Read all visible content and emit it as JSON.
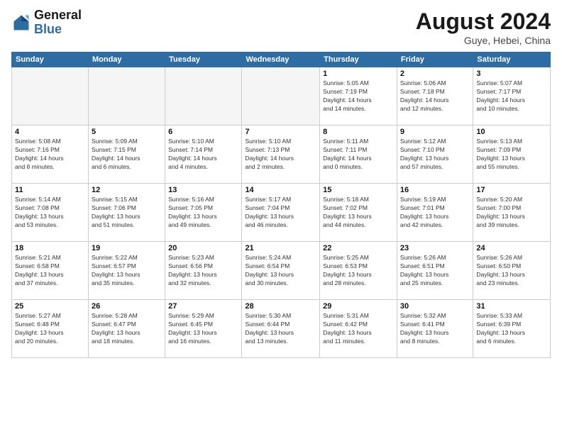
{
  "header": {
    "logo_general": "General",
    "logo_blue": "Blue",
    "month_year": "August 2024",
    "location": "Guye, Hebei, China"
  },
  "weekdays": [
    "Sunday",
    "Monday",
    "Tuesday",
    "Wednesday",
    "Thursday",
    "Friday",
    "Saturday"
  ],
  "weeks": [
    [
      {
        "day": "",
        "detail": ""
      },
      {
        "day": "",
        "detail": ""
      },
      {
        "day": "",
        "detail": ""
      },
      {
        "day": "",
        "detail": ""
      },
      {
        "day": "1",
        "detail": "Sunrise: 5:05 AM\nSunset: 7:19 PM\nDaylight: 14 hours\nand 14 minutes."
      },
      {
        "day": "2",
        "detail": "Sunrise: 5:06 AM\nSunset: 7:18 PM\nDaylight: 14 hours\nand 12 minutes."
      },
      {
        "day": "3",
        "detail": "Sunrise: 5:07 AM\nSunset: 7:17 PM\nDaylight: 14 hours\nand 10 minutes."
      }
    ],
    [
      {
        "day": "4",
        "detail": "Sunrise: 5:08 AM\nSunset: 7:16 PM\nDaylight: 14 hours\nand 8 minutes."
      },
      {
        "day": "5",
        "detail": "Sunrise: 5:09 AM\nSunset: 7:15 PM\nDaylight: 14 hours\nand 6 minutes."
      },
      {
        "day": "6",
        "detail": "Sunrise: 5:10 AM\nSunset: 7:14 PM\nDaylight: 14 hours\nand 4 minutes."
      },
      {
        "day": "7",
        "detail": "Sunrise: 5:10 AM\nSunset: 7:13 PM\nDaylight: 14 hours\nand 2 minutes."
      },
      {
        "day": "8",
        "detail": "Sunrise: 5:11 AM\nSunset: 7:11 PM\nDaylight: 14 hours\nand 0 minutes."
      },
      {
        "day": "9",
        "detail": "Sunrise: 5:12 AM\nSunset: 7:10 PM\nDaylight: 13 hours\nand 57 minutes."
      },
      {
        "day": "10",
        "detail": "Sunrise: 5:13 AM\nSunset: 7:09 PM\nDaylight: 13 hours\nand 55 minutes."
      }
    ],
    [
      {
        "day": "11",
        "detail": "Sunrise: 5:14 AM\nSunset: 7:08 PM\nDaylight: 13 hours\nand 53 minutes."
      },
      {
        "day": "12",
        "detail": "Sunrise: 5:15 AM\nSunset: 7:06 PM\nDaylight: 13 hours\nand 51 minutes."
      },
      {
        "day": "13",
        "detail": "Sunrise: 5:16 AM\nSunset: 7:05 PM\nDaylight: 13 hours\nand 49 minutes."
      },
      {
        "day": "14",
        "detail": "Sunrise: 5:17 AM\nSunset: 7:04 PM\nDaylight: 13 hours\nand 46 minutes."
      },
      {
        "day": "15",
        "detail": "Sunrise: 5:18 AM\nSunset: 7:02 PM\nDaylight: 13 hours\nand 44 minutes."
      },
      {
        "day": "16",
        "detail": "Sunrise: 5:19 AM\nSunset: 7:01 PM\nDaylight: 13 hours\nand 42 minutes."
      },
      {
        "day": "17",
        "detail": "Sunrise: 5:20 AM\nSunset: 7:00 PM\nDaylight: 13 hours\nand 39 minutes."
      }
    ],
    [
      {
        "day": "18",
        "detail": "Sunrise: 5:21 AM\nSunset: 6:58 PM\nDaylight: 13 hours\nand 37 minutes."
      },
      {
        "day": "19",
        "detail": "Sunrise: 5:22 AM\nSunset: 6:57 PM\nDaylight: 13 hours\nand 35 minutes."
      },
      {
        "day": "20",
        "detail": "Sunrise: 5:23 AM\nSunset: 6:56 PM\nDaylight: 13 hours\nand 32 minutes."
      },
      {
        "day": "21",
        "detail": "Sunrise: 5:24 AM\nSunset: 6:54 PM\nDaylight: 13 hours\nand 30 minutes."
      },
      {
        "day": "22",
        "detail": "Sunrise: 5:25 AM\nSunset: 6:53 PM\nDaylight: 13 hours\nand 28 minutes."
      },
      {
        "day": "23",
        "detail": "Sunrise: 5:26 AM\nSunset: 6:51 PM\nDaylight: 13 hours\nand 25 minutes."
      },
      {
        "day": "24",
        "detail": "Sunrise: 5:26 AM\nSunset: 6:50 PM\nDaylight: 13 hours\nand 23 minutes."
      }
    ],
    [
      {
        "day": "25",
        "detail": "Sunrise: 5:27 AM\nSunset: 6:48 PM\nDaylight: 13 hours\nand 20 minutes."
      },
      {
        "day": "26",
        "detail": "Sunrise: 5:28 AM\nSunset: 6:47 PM\nDaylight: 13 hours\nand 18 minutes."
      },
      {
        "day": "27",
        "detail": "Sunrise: 5:29 AM\nSunset: 6:45 PM\nDaylight: 13 hours\nand 16 minutes."
      },
      {
        "day": "28",
        "detail": "Sunrise: 5:30 AM\nSunset: 6:44 PM\nDaylight: 13 hours\nand 13 minutes."
      },
      {
        "day": "29",
        "detail": "Sunrise: 5:31 AM\nSunset: 6:42 PM\nDaylight: 13 hours\nand 11 minutes."
      },
      {
        "day": "30",
        "detail": "Sunrise: 5:32 AM\nSunset: 6:41 PM\nDaylight: 13 hours\nand 8 minutes."
      },
      {
        "day": "31",
        "detail": "Sunrise: 5:33 AM\nSunset: 6:39 PM\nDaylight: 13 hours\nand 6 minutes."
      }
    ]
  ]
}
